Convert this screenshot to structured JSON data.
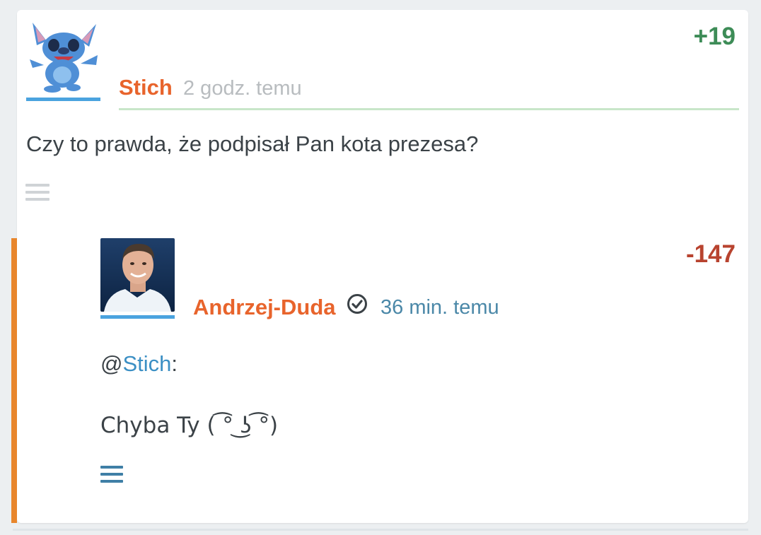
{
  "post": {
    "author": "Stich",
    "time": "2 godz. temu",
    "score": "+19",
    "body": "Czy to prawda, że podpisał Pan kota prezesa?"
  },
  "reply": {
    "author": "Andrzej-Duda",
    "time": "36 min. temu",
    "score": "-147",
    "mention_prefix": "@",
    "mention_user": "Stich",
    "mention_suffix": ":",
    "body": "Chyba Ty ( ͡° ͜ʖ ͡°)"
  },
  "colors": {
    "author": "#e8642c",
    "positive_score": "#3d8c57",
    "negative_score": "#b8432f",
    "reply_accent": "#e8862c",
    "link": "#3b8fc4"
  },
  "icons": {
    "menu": "hamburger-menu-icon",
    "verified": "verified-check-icon"
  }
}
